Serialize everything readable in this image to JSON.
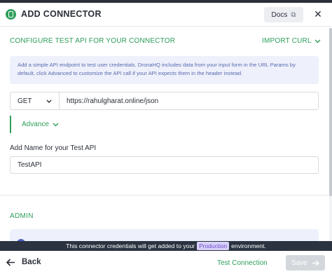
{
  "header": {
    "title": "ADD CONNECTOR",
    "docs_label": "Docs",
    "docs_icon": "external-link-icon",
    "close_icon": "close-icon"
  },
  "configure": {
    "heading": "CONFIGURE TEST API FOR YOUR CONNECTOR",
    "import_curl_label": "IMPORT CURL",
    "info_text": "Add a simple API endpoint to test user credentials. DronaHQ includes data from your input form in the URL Params by default, click Advanced to customize the API call if your API expects them in the header instead.",
    "method": "GET",
    "url": "https://rahulgharat.online/json",
    "advance_label": "Advance",
    "name_label": "Add Name for your Test API",
    "name_value": "TestAPI"
  },
  "admin": {
    "heading": "ADMIN"
  },
  "notice": {
    "before": "This connector credentials will get added to your",
    "environment": "Production",
    "after": "environment."
  },
  "footer": {
    "back_label": "Back",
    "test_label": "Test Connection",
    "save_label": "Save"
  },
  "colors": {
    "accent": "#2e9e5b",
    "info_bg": "#eef1fb",
    "notice_bg": "#2b3340",
    "env_tag_bg": "#d9d2f7"
  }
}
